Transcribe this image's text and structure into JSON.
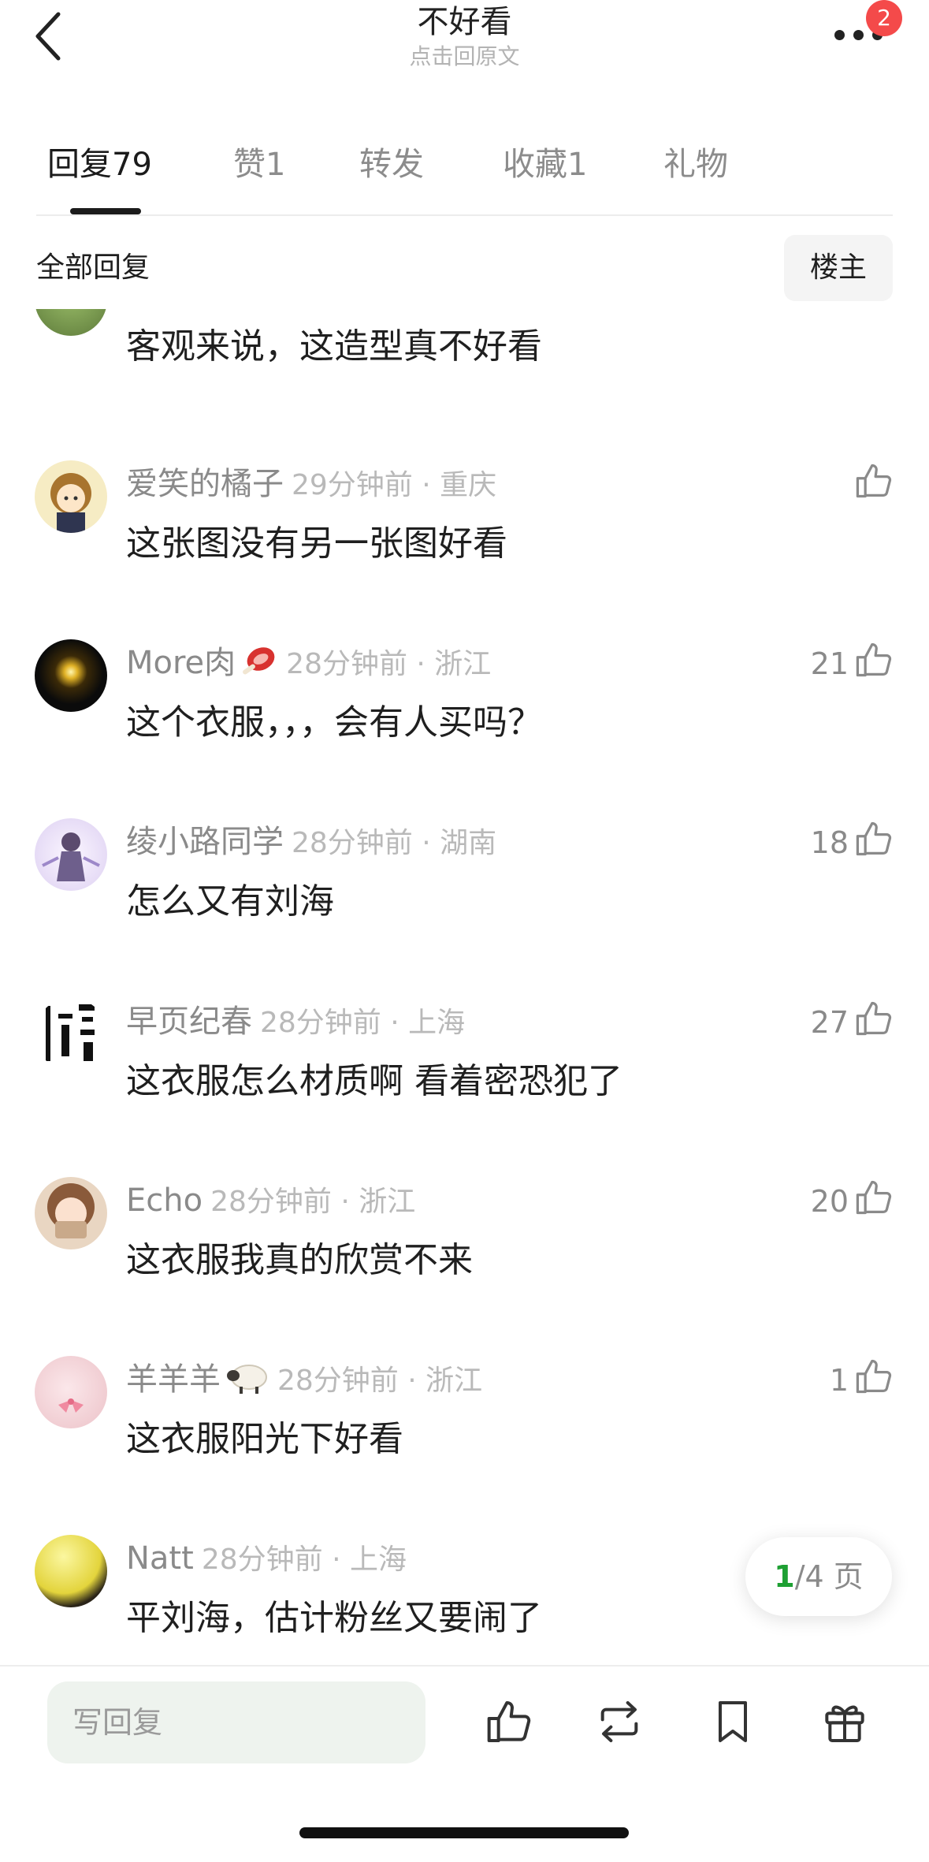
{
  "header": {
    "title": "不好看",
    "subtitle": "点击回原文",
    "more_badge": "2"
  },
  "tabs": [
    {
      "label": "回复",
      "count": "79",
      "active": true
    },
    {
      "label": "赞",
      "count": "1",
      "active": false
    },
    {
      "label": "转发",
      "count": "",
      "active": false
    },
    {
      "label": "收藏",
      "count": "1",
      "active": false
    },
    {
      "label": "礼物",
      "count": "",
      "active": false
    }
  ],
  "section": {
    "title": "全部回复",
    "owner_button": "楼主"
  },
  "comments": [
    {
      "name": "",
      "time": "",
      "text": "客观来说，这造型真不好看",
      "likes": "",
      "avatar_icon": "nature-avatar"
    },
    {
      "name": "爱笑的橘子",
      "time": "29分钟前 · 重庆",
      "text": "这张图没有另一张图好看",
      "likes": "",
      "avatar_icon": "anime-girl-avatar"
    },
    {
      "name": "More肉",
      "name_emoji": "meat-emoji",
      "time": "28分钟前 · 浙江",
      "text": "这个衣服，，，会有人买吗？",
      "likes": "21",
      "avatar_icon": "light-dark-avatar"
    },
    {
      "name": "绫小路同学",
      "time": "28分钟前 · 湖南",
      "text": "怎么又有刘海",
      "likes": "18",
      "avatar_icon": "anime-character-avatar"
    },
    {
      "name": "早页纪春",
      "time": "28分钟前 · 上海",
      "text": "这衣服怎么材质啊 看着密恐犯了",
      "likes": "27",
      "avatar_icon": "calligraphy-avatar"
    },
    {
      "name": "Echo",
      "time": "28分钟前 · 浙江",
      "text": "这衣服我真的欣赏不来",
      "likes": "20",
      "avatar_icon": "anime-brown-hair-avatar"
    },
    {
      "name": "羊羊羊",
      "name_emoji": "sheep-emoji",
      "time": "28分钟前 · 浙江",
      "text": "这衣服阳光下好看",
      "likes": "1",
      "avatar_icon": "pink-avatar"
    },
    {
      "name": "Natt",
      "time": "28分钟前 · 上海",
      "text": "平刘海，估计粉丝又要闹了",
      "likes": "",
      "avatar_icon": "yellow-dark-avatar"
    }
  ],
  "pagination": {
    "current": "1",
    "total_text": "/4 页"
  },
  "bottom_bar": {
    "reply_placeholder": "写回复",
    "icons": [
      "like-icon",
      "repost-icon",
      "bookmark-icon",
      "gift-icon"
    ]
  },
  "colors": {
    "accent_green": "#1ea033",
    "badge_red": "#f44a4a",
    "input_bg": "#eef3ee"
  }
}
